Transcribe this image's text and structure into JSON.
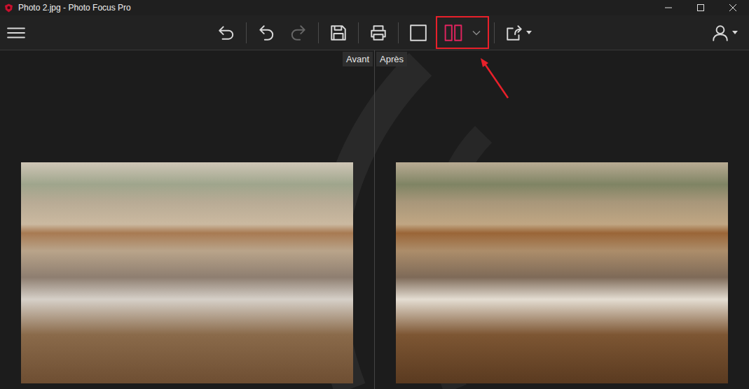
{
  "window": {
    "title": "Photo 2.jpg - Photo Focus Pro"
  },
  "toolbar": {
    "left": [
      {
        "kind": "menu",
        "disabled": false,
        "selected": false,
        "dropdown_kind": "none"
      }
    ],
    "center": [
      {
        "kind": "revert",
        "disabled": false,
        "selected": false,
        "dropdown_kind": "none"
      },
      {
        "kind": "separator",
        "disabled": false,
        "selected": false,
        "dropdown_kind": "none"
      },
      {
        "kind": "undo",
        "disabled": false,
        "selected": false,
        "dropdown_kind": "none"
      },
      {
        "kind": "redo",
        "disabled": true,
        "selected": false,
        "dropdown_kind": "none"
      },
      {
        "kind": "separator",
        "disabled": false,
        "selected": false,
        "dropdown_kind": "none"
      },
      {
        "kind": "save",
        "disabled": false,
        "selected": false,
        "dropdown_kind": "none"
      },
      {
        "kind": "separator",
        "disabled": false,
        "selected": false,
        "dropdown_kind": "none"
      },
      {
        "kind": "print",
        "disabled": false,
        "selected": false,
        "dropdown_kind": "none"
      },
      {
        "kind": "separator",
        "disabled": false,
        "selected": false,
        "dropdown_kind": "none"
      },
      {
        "kind": "single-view",
        "disabled": false,
        "selected": false,
        "dropdown_kind": "none"
      },
      {
        "kind": "split-view",
        "disabled": false,
        "selected": true,
        "dropdown_kind": "chevron"
      },
      {
        "kind": "separator",
        "disabled": false,
        "selected": false,
        "dropdown_kind": "none"
      },
      {
        "kind": "share",
        "disabled": false,
        "selected": false,
        "dropdown_kind": "caret"
      }
    ],
    "right": [
      {
        "kind": "user",
        "disabled": false,
        "selected": false,
        "dropdown_kind": "caret"
      }
    ]
  },
  "compare": {
    "panels": [
      {
        "label": "Avant",
        "kind": "before"
      },
      {
        "label": "Après",
        "kind": "after"
      }
    ]
  },
  "annotation": {
    "arrow": true
  }
}
